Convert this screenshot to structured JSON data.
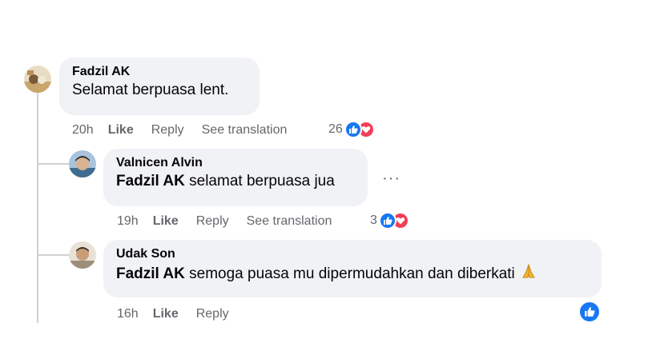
{
  "comments": [
    {
      "author": "Fadzil AK",
      "mention": "",
      "text": "Selamat berpuasa lent.",
      "time": "20h",
      "like_label": "Like",
      "reply_label": "Reply",
      "translate_label": "See translation",
      "reaction_count": "26",
      "reactions": [
        "like-icon",
        "love-icon"
      ]
    },
    {
      "author": "Valnicen Alvin",
      "mention": "Fadzil AK",
      "text": " selamat berpuasa jua",
      "time": "19h",
      "like_label": "Like",
      "reply_label": "Reply",
      "translate_label": "See translation",
      "reaction_count": "3",
      "reactions": [
        "like-icon",
        "love-icon"
      ]
    },
    {
      "author": "Udak Son",
      "mention": "Fadzil AK",
      "text": " semoga puasa mu dipermudahkan dan diberkati",
      "emoji": "folded-hands-icon",
      "time": "16h",
      "like_label": "Like",
      "reply_label": "Reply",
      "reactions": [
        "like-icon"
      ]
    }
  ],
  "more_icon": "more-options-icon",
  "colors": {
    "bubble": "#f0f2f5",
    "meta_text": "#65676b",
    "like_blue": "#1877f2",
    "love_red": "#f33e58"
  }
}
